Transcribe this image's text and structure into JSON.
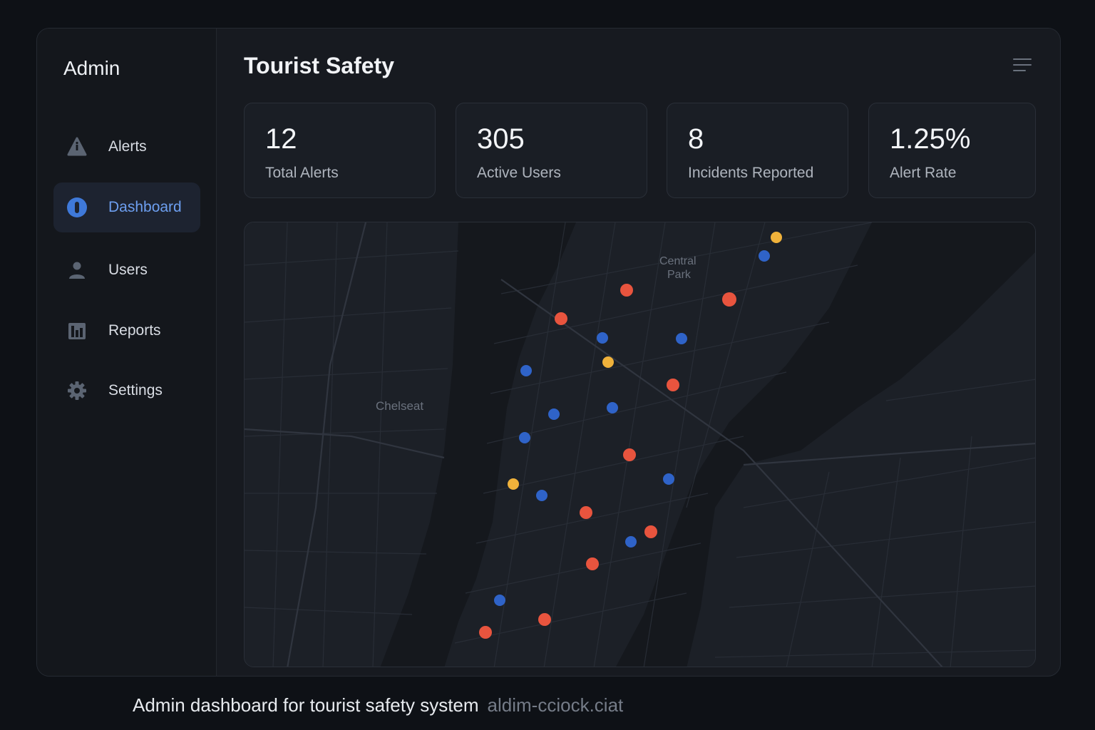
{
  "sidebar": {
    "brand": "Admin",
    "items": [
      {
        "label": "Alerts",
        "icon": "alert-icon"
      },
      {
        "label": "Dashboard",
        "icon": "dashboard-icon",
        "active": true
      },
      {
        "label": "Users",
        "icon": "user-icon"
      },
      {
        "label": "Reports",
        "icon": "reports-icon"
      },
      {
        "label": "Settings",
        "icon": "gear-icon"
      }
    ]
  },
  "header": {
    "title": "Tourist Safety",
    "menu_icon": "menu-icon"
  },
  "stats": [
    {
      "value": "12",
      "label": "Total Alerts"
    },
    {
      "value": "305",
      "label": "Active Users"
    },
    {
      "value": "8",
      "label": "Incidents Reported"
    },
    {
      "value": "1.25%",
      "label": "Alert Rate"
    }
  ],
  "map": {
    "labels": {
      "chelsea": "Chelseat",
      "central_park_1": "Central",
      "central_park_2": "Park"
    },
    "colors": {
      "high": "#e8543e",
      "medium": "#f0b23b",
      "low": "#2f63c8",
      "background": "#1c2027",
      "river": "#15181d"
    }
  },
  "caption": {
    "text": "Admin dashboard for tourist safety system",
    "url": "aldim-cciock.ciat"
  }
}
